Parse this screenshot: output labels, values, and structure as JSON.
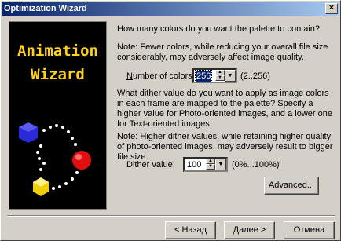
{
  "window": {
    "title": "Optimization Wizard",
    "close_glyph": "×"
  },
  "banner": {
    "line1": "Animation",
    "line2": "Wizard"
  },
  "colors": {
    "question": "How many colors do you want the palette to contain?",
    "note": "Note: Fewer colors, while reducing your overall file size considerably, may adversely affect image quality.",
    "label": "Number of colors:",
    "value": "256",
    "range": "(2..256)"
  },
  "dither": {
    "question": "What dither value do you want to apply as image colors in each frame are mapped to the palette? Specify a higher value for Photo-oriented images, and a lower one for Text-oriented images.",
    "note": "Note: Higher dither values, while retaining higher quality of photo-oriented images, may adversely result to bigger file size.",
    "label": "Dither value:",
    "value": "100",
    "range": "(0%...100%)"
  },
  "buttons": {
    "advanced": "Advanced...",
    "back": "< Назад",
    "next": "Далее >",
    "cancel": "Отмена"
  },
  "icons": {
    "spin_up": "▲",
    "spin_down": "▼",
    "dropdown": "▼"
  }
}
